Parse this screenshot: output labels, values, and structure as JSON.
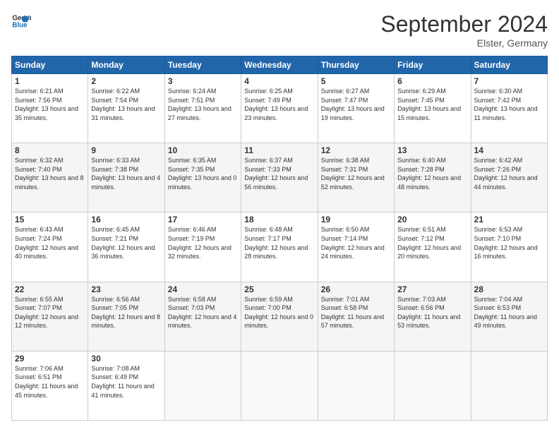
{
  "header": {
    "logo_general": "General",
    "logo_blue": "Blue",
    "month_title": "September 2024",
    "subtitle": "Elster, Germany"
  },
  "days_of_week": [
    "Sunday",
    "Monday",
    "Tuesday",
    "Wednesday",
    "Thursday",
    "Friday",
    "Saturday"
  ],
  "weeks": [
    [
      {
        "day": "1",
        "sunrise": "6:21 AM",
        "sunset": "7:56 PM",
        "daylight": "13 hours and 35 minutes."
      },
      {
        "day": "2",
        "sunrise": "6:22 AM",
        "sunset": "7:54 PM",
        "daylight": "13 hours and 31 minutes."
      },
      {
        "day": "3",
        "sunrise": "6:24 AM",
        "sunset": "7:51 PM",
        "daylight": "13 hours and 27 minutes."
      },
      {
        "day": "4",
        "sunrise": "6:25 AM",
        "sunset": "7:49 PM",
        "daylight": "13 hours and 23 minutes."
      },
      {
        "day": "5",
        "sunrise": "6:27 AM",
        "sunset": "7:47 PM",
        "daylight": "13 hours and 19 minutes."
      },
      {
        "day": "6",
        "sunrise": "6:29 AM",
        "sunset": "7:45 PM",
        "daylight": "13 hours and 15 minutes."
      },
      {
        "day": "7",
        "sunrise": "6:30 AM",
        "sunset": "7:42 PM",
        "daylight": "13 hours and 11 minutes."
      }
    ],
    [
      {
        "day": "8",
        "sunrise": "6:32 AM",
        "sunset": "7:40 PM",
        "daylight": "13 hours and 8 minutes."
      },
      {
        "day": "9",
        "sunrise": "6:33 AM",
        "sunset": "7:38 PM",
        "daylight": "13 hours and 4 minutes."
      },
      {
        "day": "10",
        "sunrise": "6:35 AM",
        "sunset": "7:35 PM",
        "daylight": "13 hours and 0 minutes."
      },
      {
        "day": "11",
        "sunrise": "6:37 AM",
        "sunset": "7:33 PM",
        "daylight": "12 hours and 56 minutes."
      },
      {
        "day": "12",
        "sunrise": "6:38 AM",
        "sunset": "7:31 PM",
        "daylight": "12 hours and 52 minutes."
      },
      {
        "day": "13",
        "sunrise": "6:40 AM",
        "sunset": "7:28 PM",
        "daylight": "12 hours and 48 minutes."
      },
      {
        "day": "14",
        "sunrise": "6:42 AM",
        "sunset": "7:26 PM",
        "daylight": "12 hours and 44 minutes."
      }
    ],
    [
      {
        "day": "15",
        "sunrise": "6:43 AM",
        "sunset": "7:24 PM",
        "daylight": "12 hours and 40 minutes."
      },
      {
        "day": "16",
        "sunrise": "6:45 AM",
        "sunset": "7:21 PM",
        "daylight": "12 hours and 36 minutes."
      },
      {
        "day": "17",
        "sunrise": "6:46 AM",
        "sunset": "7:19 PM",
        "daylight": "12 hours and 32 minutes."
      },
      {
        "day": "18",
        "sunrise": "6:48 AM",
        "sunset": "7:17 PM",
        "daylight": "12 hours and 28 minutes."
      },
      {
        "day": "19",
        "sunrise": "6:50 AM",
        "sunset": "7:14 PM",
        "daylight": "12 hours and 24 minutes."
      },
      {
        "day": "20",
        "sunrise": "6:51 AM",
        "sunset": "7:12 PM",
        "daylight": "12 hours and 20 minutes."
      },
      {
        "day": "21",
        "sunrise": "6:53 AM",
        "sunset": "7:10 PM",
        "daylight": "12 hours and 16 minutes."
      }
    ],
    [
      {
        "day": "22",
        "sunrise": "6:55 AM",
        "sunset": "7:07 PM",
        "daylight": "12 hours and 12 minutes."
      },
      {
        "day": "23",
        "sunrise": "6:56 AM",
        "sunset": "7:05 PM",
        "daylight": "12 hours and 8 minutes."
      },
      {
        "day": "24",
        "sunrise": "6:58 AM",
        "sunset": "7:03 PM",
        "daylight": "12 hours and 4 minutes."
      },
      {
        "day": "25",
        "sunrise": "6:59 AM",
        "sunset": "7:00 PM",
        "daylight": "12 hours and 0 minutes."
      },
      {
        "day": "26",
        "sunrise": "7:01 AM",
        "sunset": "6:58 PM",
        "daylight": "11 hours and 57 minutes."
      },
      {
        "day": "27",
        "sunrise": "7:03 AM",
        "sunset": "6:56 PM",
        "daylight": "11 hours and 53 minutes."
      },
      {
        "day": "28",
        "sunrise": "7:04 AM",
        "sunset": "6:53 PM",
        "daylight": "11 hours and 49 minutes."
      }
    ],
    [
      {
        "day": "29",
        "sunrise": "7:06 AM",
        "sunset": "6:51 PM",
        "daylight": "11 hours and 45 minutes."
      },
      {
        "day": "30",
        "sunrise": "7:08 AM",
        "sunset": "6:49 PM",
        "daylight": "11 hours and 41 minutes."
      },
      null,
      null,
      null,
      null,
      null
    ]
  ]
}
